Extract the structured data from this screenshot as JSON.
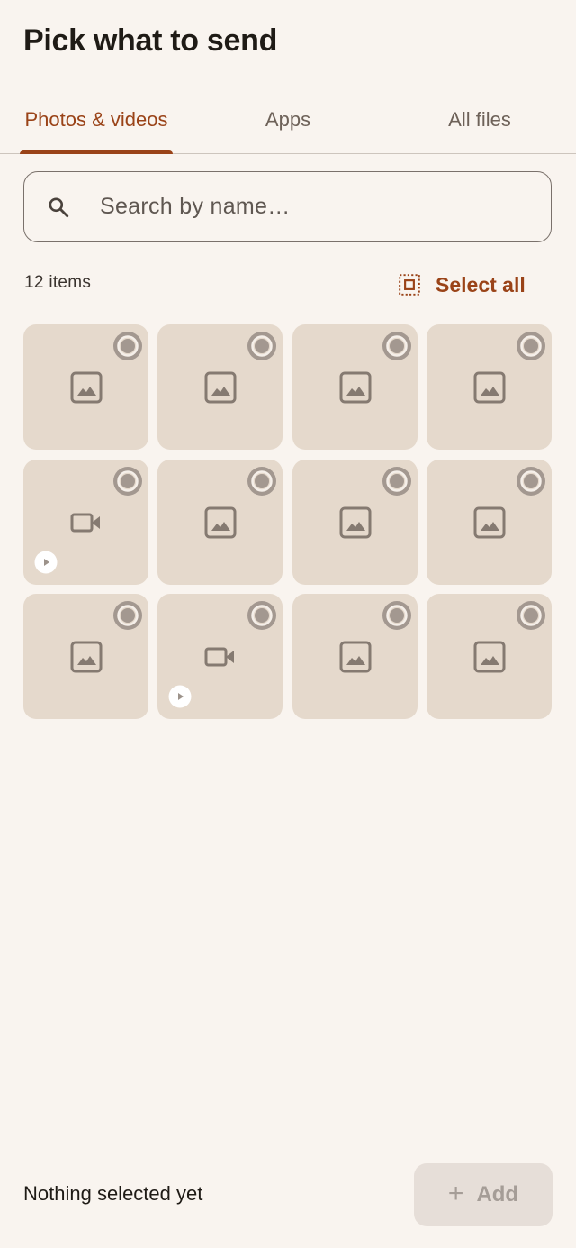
{
  "title": "Pick what to send",
  "tabs": [
    {
      "label": "Photos & videos",
      "active": true
    },
    {
      "label": "Apps",
      "active": false
    },
    {
      "label": "All files",
      "active": false
    }
  ],
  "search": {
    "placeholder": "Search by name…",
    "value": ""
  },
  "item_count": "12 items",
  "select_all_label": "Select all",
  "items": [
    {
      "type": "image",
      "selected": false
    },
    {
      "type": "image",
      "selected": false
    },
    {
      "type": "image",
      "selected": false
    },
    {
      "type": "image",
      "selected": false
    },
    {
      "type": "video",
      "selected": false
    },
    {
      "type": "image",
      "selected": false
    },
    {
      "type": "image",
      "selected": false
    },
    {
      "type": "image",
      "selected": false
    },
    {
      "type": "image",
      "selected": false
    },
    {
      "type": "video",
      "selected": false
    },
    {
      "type": "image",
      "selected": false
    },
    {
      "type": "image",
      "selected": false
    }
  ],
  "footer": {
    "status_text": "Nothing selected yet",
    "add_label": "Add",
    "add_icon": "plus-icon",
    "add_enabled": false
  },
  "colors": {
    "accent": "#9a4318",
    "background": "#f9f4ef",
    "tile": "#e5d9cc"
  }
}
